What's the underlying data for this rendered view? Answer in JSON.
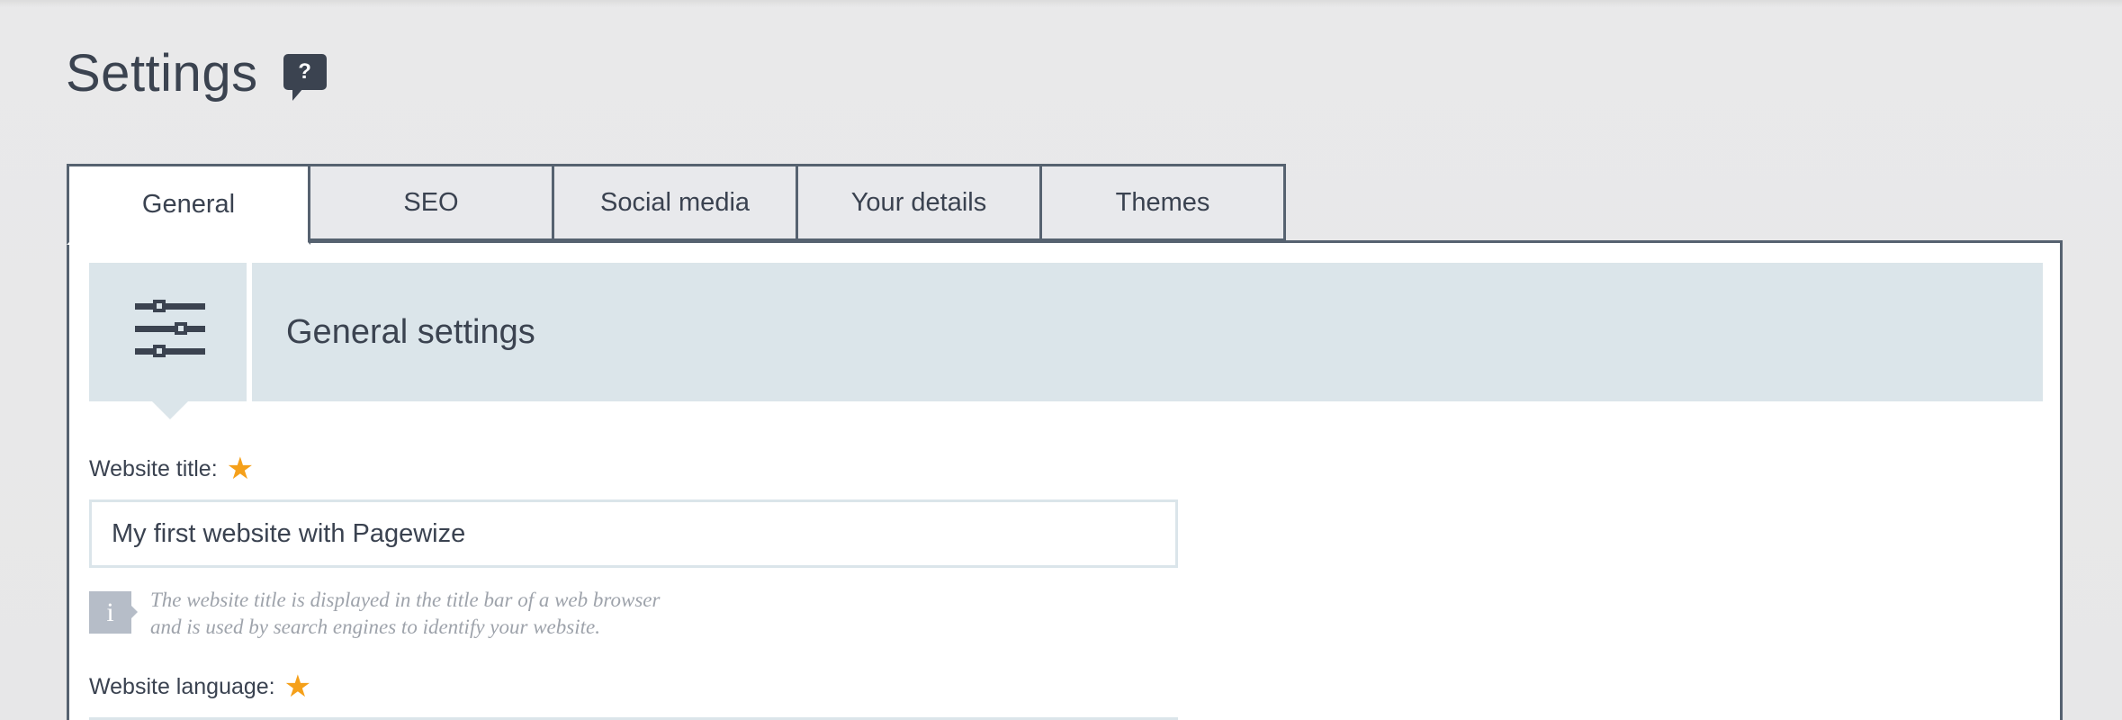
{
  "page": {
    "title": "Settings",
    "help_icon_label": "?"
  },
  "tabs": [
    {
      "label": "General",
      "active": true
    },
    {
      "label": "SEO",
      "active": false
    },
    {
      "label": "Social media",
      "active": false
    },
    {
      "label": "Your details",
      "active": false
    },
    {
      "label": "Themes",
      "active": false
    }
  ],
  "section": {
    "title": "General settings",
    "icon": "sliders-icon"
  },
  "fields": {
    "website_title": {
      "label": "Website title:",
      "value": "My first website with Pagewize",
      "required": true,
      "hint_line1": "The website title is displayed in the title bar of a web browser",
      "hint_line2": "and is used by search engines to identify your website."
    },
    "website_language": {
      "label": "Website language:",
      "required": true
    }
  },
  "colors": {
    "accent_star": "#f5a01a",
    "header_band": "#dbe5ea",
    "border": "#566270",
    "text": "#3a4250"
  }
}
